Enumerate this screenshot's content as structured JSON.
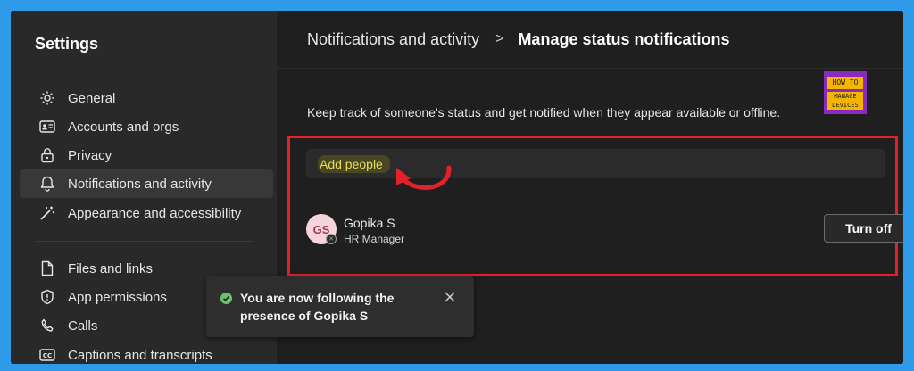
{
  "sidebar": {
    "title": "Settings",
    "items": [
      {
        "label": "General",
        "icon": "gear-icon"
      },
      {
        "label": "Accounts and orgs",
        "icon": "id-card-icon"
      },
      {
        "label": "Privacy",
        "icon": "lock-icon"
      },
      {
        "label": "Notifications and activity",
        "icon": "bell-icon",
        "active": true
      },
      {
        "label": "Appearance and accessibility",
        "icon": "magic-wand-icon"
      },
      {
        "label": "Files and links",
        "icon": "file-icon"
      },
      {
        "label": "App permissions",
        "icon": "shield-icon"
      },
      {
        "label": "Calls",
        "icon": "phone-icon"
      },
      {
        "label": "Captions and transcripts",
        "icon": "captions-icon"
      }
    ]
  },
  "header": {
    "breadcrumb_parent": "Notifications and activity",
    "separator": ">",
    "title": "Manage status notifications"
  },
  "logo": {
    "line1": "HOW TO",
    "line2a": "MANAGE",
    "line2b": "DEVICES"
  },
  "main": {
    "description": "Keep track of someone's status and get notified when they appear available or offline.",
    "add_people_placeholder": "Add people",
    "person": {
      "initials": "GS",
      "name": "Gopika S",
      "role": "HR Manager",
      "presence": "offline"
    },
    "turn_off_label": "Turn off"
  },
  "toast": {
    "message": "You are now following the presence of Gopika S",
    "status": "success"
  },
  "colors": {
    "highlight": "#e3202c",
    "accent_yellow": "#e9df5a",
    "success": "#6cc26f"
  }
}
